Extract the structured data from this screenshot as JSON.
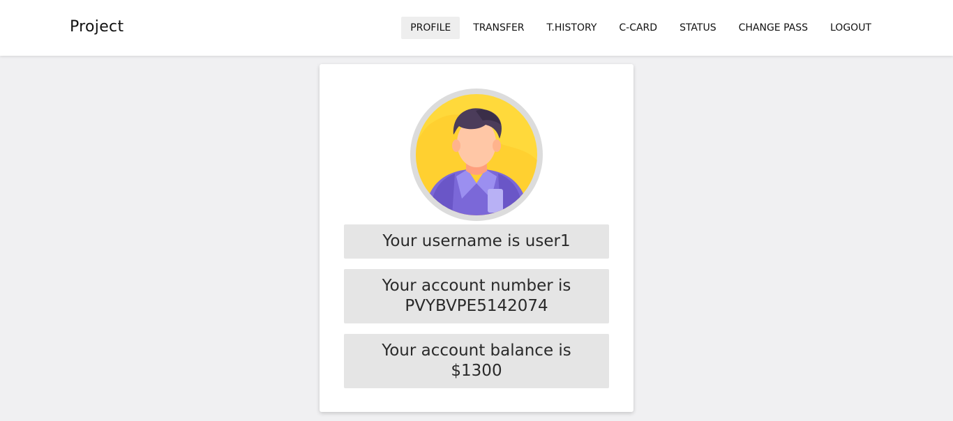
{
  "navbar": {
    "brand": "Project",
    "items": [
      {
        "label": "PROFILE",
        "active": true
      },
      {
        "label": "TRANSFER",
        "active": false
      },
      {
        "label": "T.HISTORY",
        "active": false
      },
      {
        "label": "C-CARD",
        "active": false
      },
      {
        "label": "STATUS",
        "active": false
      },
      {
        "label": "CHANGE PASS",
        "active": false
      },
      {
        "label": "LOGOUT",
        "active": false
      }
    ]
  },
  "profile": {
    "avatar_icon": "user-avatar-icon",
    "username_text": "Your username is user1",
    "account_number_prefix": "Your account number is",
    "account_number": "PVYBVPE5142074",
    "balance_prefix": "Your account balance is",
    "balance": "$1300"
  },
  "colors": {
    "page_background": "#f0f0f2",
    "card_background": "#ffffff",
    "info_background": "#e5e5e5",
    "active_nav_background": "#eeeeee",
    "avatar_yellow": "#ffd93b",
    "shirt_purple": "#7b68d8"
  }
}
